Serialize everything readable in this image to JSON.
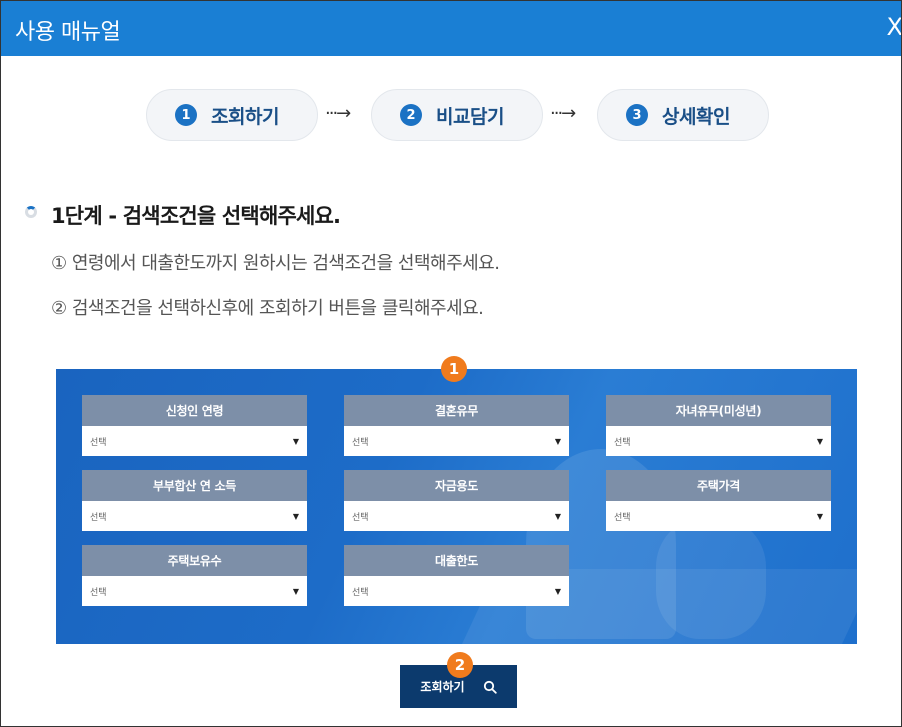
{
  "window": {
    "title": "사용 매뉴얼",
    "close_label": "X"
  },
  "steps": [
    {
      "num": "1",
      "label": "조회하기"
    },
    {
      "num": "2",
      "label": "비교담기"
    },
    {
      "num": "3",
      "label": "상세확인"
    }
  ],
  "arrow": "···→",
  "section": {
    "title": "1단계 - 검색조건을 선택해주세요.",
    "instructions": [
      "① 연령에서 대출한도까지 원하시는 검색조건을 선택해주세요.",
      "② 검색조건을 선택하신후에 조회하기 버튼을 클릭해주세요."
    ]
  },
  "form": {
    "badge1": "1",
    "badge2": "2",
    "fields": [
      {
        "label": "신청인 연령",
        "value": "선택"
      },
      {
        "label": "결혼유무",
        "value": "선택"
      },
      {
        "label": "자녀유무(미성년)",
        "value": "선택"
      },
      {
        "label": "부부합산 연 소득",
        "value": "선택"
      },
      {
        "label": "자금용도",
        "value": "선택"
      },
      {
        "label": "주택가격",
        "value": "선택"
      },
      {
        "label": "주택보유수",
        "value": "선택"
      },
      {
        "label": "대출한도",
        "value": "선택"
      }
    ],
    "search_button": "조회하기"
  },
  "colors": {
    "title_bar": "#1a7fd4",
    "step_num": "#1b72c4",
    "badge": "#f07b1d",
    "field_head": "#7d8fa8",
    "button": "#0c3a6d"
  }
}
